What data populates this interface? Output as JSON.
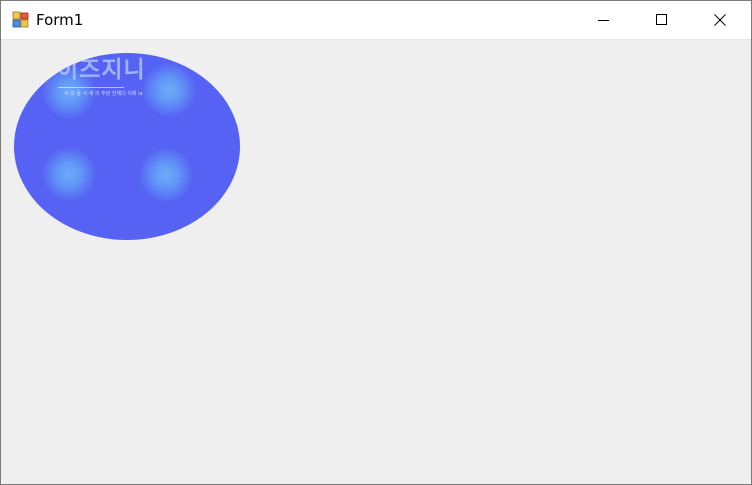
{
  "window": {
    "title": "Form1",
    "icons": {
      "app": "winforms-app-icon",
      "minimize": "minimize-icon",
      "maximize": "maximize-icon",
      "close": "close-icon"
    }
  },
  "client": {
    "background": "#efefef",
    "picture": {
      "shape": "ellipse",
      "base_color": "#5662f4",
      "highlight_color": "#6eaaf8",
      "watermark_text": "이즈지니",
      "watermark_subtext": "수 꼬 용 서 새 의 주장 전체더 이해 ia"
    }
  }
}
